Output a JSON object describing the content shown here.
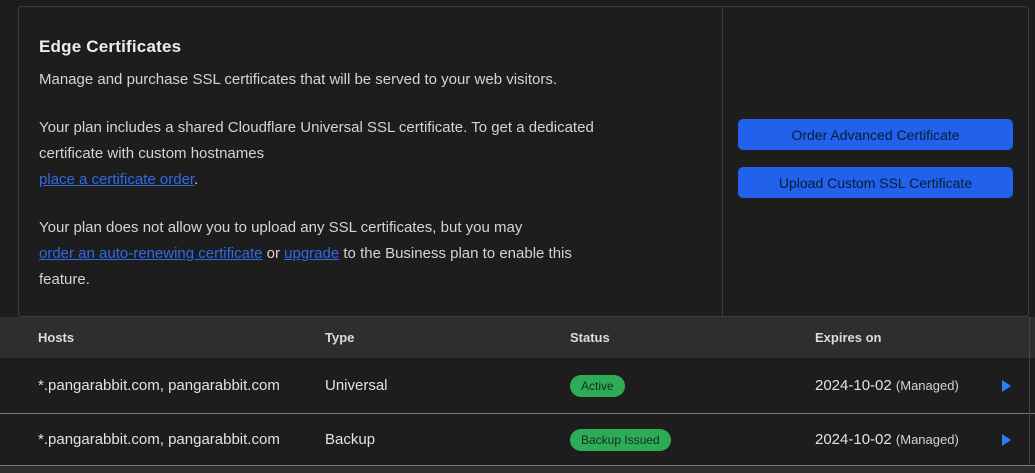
{
  "panel": {
    "title": "Edge Certificates",
    "subtitle": "Manage and purchase SSL certificates that will be served to your web visitors.",
    "para_universal": {
      "line1": "Your plan includes a shared Cloudflare Universal SSL certificate. To get a dedicated",
      "line2": "certificate with custom hostnames",
      "link": "place a certificate order",
      "suffix": "."
    },
    "para_upload": {
      "line1": "Your plan does not allow you to upload any SSL certificates, but you may",
      "link1": "order an auto-renewing certificate",
      "mid": " or ",
      "link2": "upgrade",
      "after": " to the Business plan to enable this",
      "line3": "feature."
    }
  },
  "actions": {
    "order_button": "Order Advanced Certificate",
    "upload_button": "Upload Custom SSL Certificate"
  },
  "table": {
    "columns": {
      "hosts": "Hosts",
      "type": "Type",
      "status": "Status",
      "expires": "Expires on"
    },
    "rows": [
      {
        "hosts": "*.pangarabbit.com, pangarabbit.com",
        "type": "Universal",
        "status": "Active",
        "expires": "2024-10-02",
        "managed": "(Managed)"
      },
      {
        "hosts": "*.pangarabbit.com, pangarabbit.com",
        "type": "Backup",
        "status": "Backup Issued",
        "expires": "2024-10-02",
        "managed": "(Managed)"
      }
    ]
  },
  "colors": {
    "accent_blue": "#2161ec",
    "link_blue": "#2f6be5",
    "badge_green": "#2eab57",
    "caret_blue": "#2e7cf6",
    "background": "#1d1d1e",
    "header_row": "#2e2e30"
  }
}
